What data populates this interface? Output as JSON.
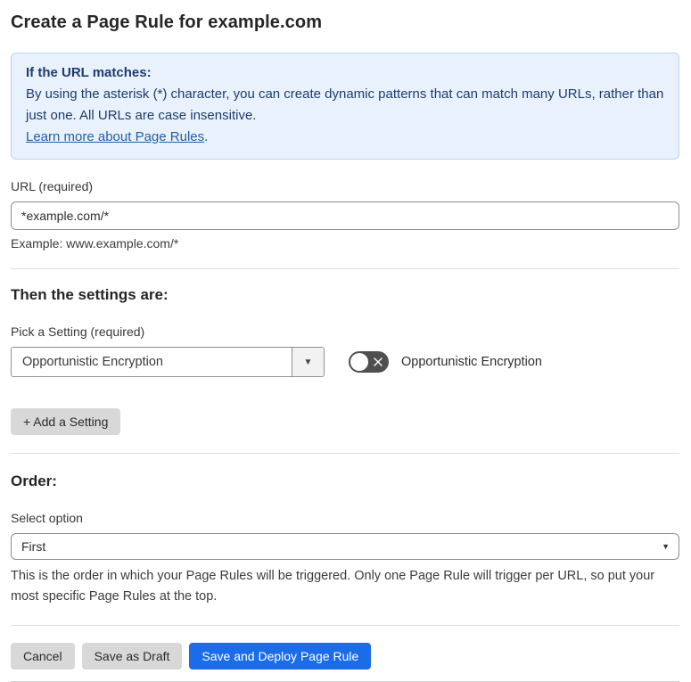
{
  "page": {
    "title": "Create a Page Rule for example.com"
  },
  "info_banner": {
    "heading": "If the URL matches:",
    "body": "By using the asterisk (*) character, you can create dynamic patterns that can match many URLs, rather than just one. All URLs are case insensitive.",
    "link_label": "Learn more about Page Rules",
    "link_suffix": "."
  },
  "url_field": {
    "label": "URL (required)",
    "value": "*example.com/*",
    "helper": "Example: www.example.com/*"
  },
  "settings_section": {
    "heading": "Then the settings are:",
    "picker_label": "Pick a Setting (required)",
    "selected_setting": "Opportunistic Encryption",
    "dropdown_arrow": "▼",
    "toggle": {
      "state": "off",
      "label": "Opportunistic Encryption"
    },
    "add_setting_label": "+ Add a Setting"
  },
  "order_section": {
    "heading": "Order:",
    "select_label": "Select option",
    "selected_option": "First",
    "chevron": "▼",
    "description": "This is the order in which your Page Rules will be triggered. Only one Page Rule will trigger per URL, so put your most specific Page Rules at the top."
  },
  "footer": {
    "cancel_label": "Cancel",
    "save_draft_label": "Save as Draft",
    "save_deploy_label": "Save and Deploy Page Rule"
  },
  "colors": {
    "banner_bg": "#e9f2fc",
    "banner_border": "#b9d5f1",
    "banner_text": "#1d3c6e",
    "link": "#2160a8",
    "primary_button": "#1a6ce8",
    "secondary_button": "#d8d8d8",
    "toggle_off": "#4f4f4f"
  }
}
